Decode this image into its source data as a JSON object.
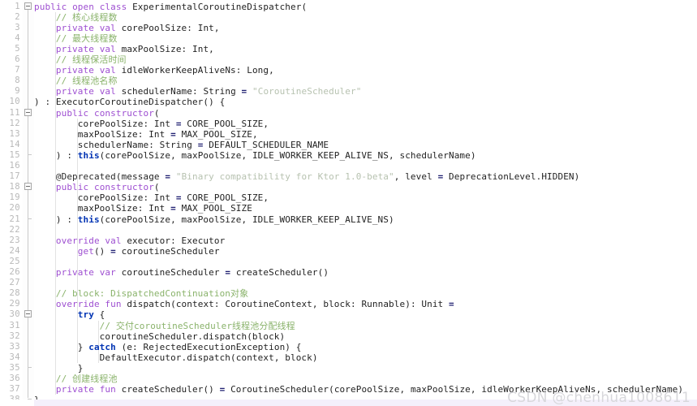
{
  "editor": {
    "language": "Kotlin",
    "first_line": 1,
    "last_line": 38,
    "line_height_px": 13.1,
    "colors": {
      "background": "#ffffff",
      "keyword": "#9e4fd1",
      "keyword_bold": "#0033b3",
      "comment": "#8ab36b",
      "string": "#b7c2b0",
      "text": "#222222",
      "gutter_text": "#b8b8b8",
      "indent_guide": "#e2e2e2",
      "bottom_strip": "#f4f0fb",
      "watermark": "#d8d8dc"
    }
  },
  "watermark": {
    "text": "CSDN @chenhua1008611"
  },
  "line_numbers": [
    1,
    2,
    3,
    4,
    5,
    6,
    7,
    8,
    9,
    10,
    11,
    12,
    13,
    14,
    15,
    16,
    17,
    18,
    19,
    20,
    21,
    22,
    23,
    24,
    25,
    26,
    27,
    28,
    29,
    30,
    31,
    32,
    33,
    34,
    35,
    36,
    37,
    38
  ],
  "fold_markers": [
    {
      "line": 1,
      "type": "collapse-box"
    },
    {
      "line": 11,
      "type": "collapse-box"
    },
    {
      "line": 15,
      "type": "fold-end-tick"
    },
    {
      "line": 18,
      "type": "collapse-box"
    },
    {
      "line": 21,
      "type": "fold-end-tick"
    },
    {
      "line": 30,
      "type": "collapse-box"
    },
    {
      "line": 35,
      "type": "fold-end-tick"
    },
    {
      "line": 38,
      "type": "fold-end-tick"
    }
  ],
  "lines": [
    {
      "n": 1,
      "indent": 0,
      "text": "public open class ExperimentalCoroutineDispatcher("
    },
    {
      "n": 2,
      "indent": 4,
      "text": "// 核心线程数"
    },
    {
      "n": 3,
      "indent": 4,
      "text": "private val corePoolSize: Int,"
    },
    {
      "n": 4,
      "indent": 4,
      "text": "// 最大线程数"
    },
    {
      "n": 5,
      "indent": 4,
      "text": "private val maxPoolSize: Int,"
    },
    {
      "n": 6,
      "indent": 4,
      "text": "// 线程保活时间"
    },
    {
      "n": 7,
      "indent": 4,
      "text": "private val idleWorkerKeepAliveNs: Long,"
    },
    {
      "n": 8,
      "indent": 4,
      "text": "// 线程池名称"
    },
    {
      "n": 9,
      "indent": 4,
      "text": "private val schedulerName: String = \"CoroutineScheduler\""
    },
    {
      "n": 10,
      "indent": 0,
      "text": ") : ExecutorCoroutineDispatcher() {"
    },
    {
      "n": 11,
      "indent": 4,
      "text": "public constructor("
    },
    {
      "n": 12,
      "indent": 8,
      "text": "corePoolSize: Int = CORE_POOL_SIZE,"
    },
    {
      "n": 13,
      "indent": 8,
      "text": "maxPoolSize: Int = MAX_POOL_SIZE,"
    },
    {
      "n": 14,
      "indent": 8,
      "text": "schedulerName: String = DEFAULT_SCHEDULER_NAME"
    },
    {
      "n": 15,
      "indent": 4,
      "text": ") : this(corePoolSize, maxPoolSize, IDLE_WORKER_KEEP_ALIVE_NS, schedulerName)"
    },
    {
      "n": 16,
      "indent": 0,
      "text": ""
    },
    {
      "n": 17,
      "indent": 4,
      "text": "@Deprecated(message = \"Binary compatibility for Ktor 1.0-beta\", level = DeprecationLevel.HIDDEN)"
    },
    {
      "n": 18,
      "indent": 4,
      "text": "public constructor("
    },
    {
      "n": 19,
      "indent": 8,
      "text": "corePoolSize: Int = CORE_POOL_SIZE,"
    },
    {
      "n": 20,
      "indent": 8,
      "text": "maxPoolSize: Int = MAX_POOL_SIZE"
    },
    {
      "n": 21,
      "indent": 4,
      "text": ") : this(corePoolSize, maxPoolSize, IDLE_WORKER_KEEP_ALIVE_NS)"
    },
    {
      "n": 22,
      "indent": 0,
      "text": ""
    },
    {
      "n": 23,
      "indent": 4,
      "text": "override val executor: Executor"
    },
    {
      "n": 24,
      "indent": 8,
      "text": "get() = coroutineScheduler"
    },
    {
      "n": 25,
      "indent": 0,
      "text": ""
    },
    {
      "n": 26,
      "indent": 4,
      "text": "private var coroutineScheduler = createScheduler()"
    },
    {
      "n": 27,
      "indent": 0,
      "text": ""
    },
    {
      "n": 28,
      "indent": 4,
      "text": "// block: DispatchedContinuation对象"
    },
    {
      "n": 29,
      "indent": 4,
      "text": "override fun dispatch(context: CoroutineContext, block: Runnable): Unit ="
    },
    {
      "n": 30,
      "indent": 8,
      "text": "try {"
    },
    {
      "n": 31,
      "indent": 12,
      "text": "// 交付coroutineScheduler线程池分配线程"
    },
    {
      "n": 32,
      "indent": 12,
      "text": "coroutineScheduler.dispatch(block)"
    },
    {
      "n": 33,
      "indent": 8,
      "text": "} catch (e: RejectedExecutionException) {"
    },
    {
      "n": 34,
      "indent": 12,
      "text": "DefaultExecutor.dispatch(context, block)"
    },
    {
      "n": 35,
      "indent": 8,
      "text": "}"
    },
    {
      "n": 36,
      "indent": 4,
      "text": "// 创建线程池"
    },
    {
      "n": 37,
      "indent": 4,
      "text": "private fun createScheduler() = CoroutineScheduler(corePoolSize, maxPoolSize, idleWorkerKeepAliveNs, schedulerName)"
    },
    {
      "n": 38,
      "indent": 0,
      "text": "}"
    }
  ],
  "tokens": {
    "keywords_purple": [
      "public",
      "open",
      "class",
      "private",
      "val",
      "var",
      "fun",
      "override",
      "get",
      "constructor"
    ],
    "keywords_blue_bold": [
      "this",
      "try",
      "catch"
    ],
    "strings": [
      "\"CoroutineScheduler\"",
      "\"Binary compatibility for Ktor 1.0-beta\""
    ],
    "comments": [
      "// 核心线程数",
      "// 最大线程数",
      "// 线程保活时间",
      "// 线程池名称",
      "// block: DispatchedContinuation对象",
      "// 交付coroutineScheduler线程池分配线程",
      "// 创建线程池"
    ],
    "constants": [
      "CORE_POOL_SIZE",
      "MAX_POOL_SIZE",
      "DEFAULT_SCHEDULER_NAME",
      "IDLE_WORKER_KEEP_ALIVE_NS"
    ],
    "types": [
      "Int",
      "Long",
      "String",
      "Executor",
      "CoroutineContext",
      "Runnable",
      "Unit",
      "ExecutorCoroutineDispatcher",
      "CoroutineScheduler",
      "RejectedExecutionException",
      "DefaultExecutor",
      "DeprecationLevel.HIDDEN"
    ],
    "annotation": "@Deprecated"
  }
}
